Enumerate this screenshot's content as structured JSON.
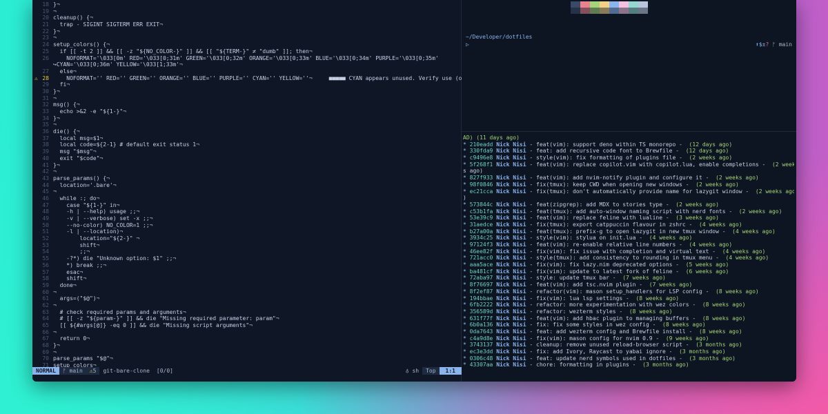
{
  "editor": {
    "lines": [
      {
        "n": "18",
        "t": "}¬"
      },
      {
        "n": "19",
        "t": "¬"
      },
      {
        "n": "20",
        "t": "cleanup() {¬"
      },
      {
        "n": "21",
        "t": "  trap - SIGINT SIGTERM ERR EXIT¬"
      },
      {
        "n": "22",
        "t": "}¬"
      },
      {
        "n": "23",
        "t": "¬"
      },
      {
        "n": "24",
        "t": "setup_colors() {¬"
      },
      {
        "n": "25",
        "t": "  if [[ -t 2 ]] && [[ -z \"${NO_COLOR-}\" ]] && [[ \"${TERM-}\" ≠ \"dumb\" ]]; then¬"
      },
      {
        "n": "26",
        "t": "    NOFORMAT='\\033[0m' RED='\\033[0;31m' GREEN='\\033[0;32m' ORANGE='\\033[0;33m' BLUE='\\033[0;34m' PURPLE='\\033[0;35m'"
      },
      {
        "n": "",
        "t": "↪CYAN='\\033[0;36m' YELLOW='\\033[1;33m'¬"
      },
      {
        "n": "27",
        "t": "  else¬"
      },
      {
        "n": "28",
        "t": "    NOFORMAT='' RED='' GREEN='' ORANGE='' BLUE='' PURPLE='' CYAN='' YELLOW=''¬     ■■■■■ CYAN appears unused. Verify use (or e",
        "warn": true
      },
      {
        "n": "29",
        "t": "  fi¬"
      },
      {
        "n": "30",
        "t": "}¬"
      },
      {
        "n": "31",
        "t": "¬"
      },
      {
        "n": "32",
        "t": "msg() {¬"
      },
      {
        "n": "33",
        "t": "  echo >&2 -e \"${1-}\"¬"
      },
      {
        "n": "34",
        "t": "}¬"
      },
      {
        "n": "35",
        "t": "¬"
      },
      {
        "n": "36",
        "t": "die() {¬"
      },
      {
        "n": "37",
        "t": "  local msg=$1¬"
      },
      {
        "n": "38",
        "t": "  local code=${2-1} # default exit status 1¬"
      },
      {
        "n": "39",
        "t": "  msg \"$msg\"¬"
      },
      {
        "n": "40",
        "t": "  exit \"$code\"¬"
      },
      {
        "n": "41",
        "t": "}¬"
      },
      {
        "n": "42",
        "t": "¬"
      },
      {
        "n": "43",
        "t": "parse_params() {¬"
      },
      {
        "n": "44",
        "t": "  location='.bare'¬"
      },
      {
        "n": "45",
        "t": "¬"
      },
      {
        "n": "46",
        "t": "  while :; do¬"
      },
      {
        "n": "47",
        "t": "    case \"${1-}\" in¬"
      },
      {
        "n": "48",
        "t": "    -h | --help) usage ;;¬"
      },
      {
        "n": "49",
        "t": "    -v | --verbose) set -x ;;¬"
      },
      {
        "n": "50",
        "t": "    --no-color) NO_COLOR=1 ;;¬"
      },
      {
        "n": "51",
        "t": "    -l | --location)¬"
      },
      {
        "n": "52",
        "t": "        location=\"${2-}\" ¬"
      },
      {
        "n": "53",
        "t": "        shift¬"
      },
      {
        "n": "54",
        "t": "        ;;¬"
      },
      {
        "n": "55",
        "t": "    -?*) die \"Unknown option: $1\" ;;¬"
      },
      {
        "n": "56",
        "t": "    *) break ;;¬"
      },
      {
        "n": "57",
        "t": "    esac¬"
      },
      {
        "n": "58",
        "t": "    shift¬"
      },
      {
        "n": "59",
        "t": "  done¬"
      },
      {
        "n": "60",
        "t": "¬"
      },
      {
        "n": "61",
        "t": "  args=(\"$@\")¬"
      },
      {
        "n": "62",
        "t": "¬"
      },
      {
        "n": "63",
        "t": "  # check required params and arguments¬"
      },
      {
        "n": "64",
        "t": "  # [[ -z \"${param-}\" ]] && die \"Missing required parameter: param\"¬"
      },
      {
        "n": "65",
        "t": "  [[ ${#args[@]} -eq 0 ]] && die \"Missing script arguments\"¬"
      },
      {
        "n": "66",
        "t": "¬"
      },
      {
        "n": "67",
        "t": "  return 0¬"
      },
      {
        "n": "68",
        "t": "}¬"
      },
      {
        "n": "69",
        "t": "¬"
      },
      {
        "n": "70",
        "t": "parse_params \"$@\"¬"
      },
      {
        "n": "71",
        "t": "setup_colors¬"
      }
    ],
    "status": {
      "mode": "NORMAL",
      "branch": "main",
      "warnings": "5",
      "file": "git-bare-clone",
      "count": "[0/0]",
      "filetype": "sh",
      "position": "Top",
      "cursor": "1:1"
    }
  },
  "terminal": {
    "cwd": "~/Developer/dotfiles",
    "prompt": "▷",
    "git_icons": "⬆$±",
    "git_q": "?",
    "git_branch": "main",
    "swatches": [
      "#3a4a66",
      "#e8828f",
      "#a6d27a",
      "#f2d085",
      "#8ab4ee",
      "#f5bfe2",
      "#94d6d0",
      "#b8c4dc"
    ],
    "log_head": "AD) (11 days ago)",
    "log": [
      {
        "h": "210eadd",
        "a": "Nick Nisi",
        "m": " - feat(vim): support deno within TS monorepo -",
        "d": "  (12 days ago)"
      },
      {
        "h": "330fda9",
        "a": "Nick Nisi",
        "m": " - feat: add recursive code font to Brewfile -",
        "d": "  (12 days ago)"
      },
      {
        "h": "c9496e8",
        "a": "Nick Nisi",
        "m": " - style(vim): fix formatting of plugins file -",
        "d": "  (2 weeks ago)"
      },
      {
        "h": "5f268f1",
        "a": "Nick Nisi",
        "m": " - feat(vim): replace copilot.vim with copilot.lua, enable completions -",
        "d": "  (2 week"
      },
      {
        "h": "",
        "a": "",
        "m": "s ago)",
        "d": ""
      },
      {
        "h": "827f933",
        "a": "Nick Nisi",
        "m": " - feat(vim): add nvim-notify plugin and configure it -",
        "d": "  (2 weeks ago)"
      },
      {
        "h": "98f0846",
        "a": "Nick Nisi",
        "m": " - fix(tmux): keep CWD when opening new windows -",
        "d": "  (2 weeks ago)"
      },
      {
        "h": "ec21cca",
        "a": "Nick Nisi",
        "m": " - fix(tmux): don't automatically provide name for lazygit window -",
        "d": "  (2 weeks ago"
      },
      {
        "h": "",
        "a": "",
        "m": ")",
        "d": ""
      },
      {
        "h": "573844c",
        "a": "Nick Nisi",
        "m": " - feat(zipgrep): add MDX to stories type -",
        "d": "  (2 weeks ago)"
      },
      {
        "h": "c53b1fa",
        "a": "Nick Nisi",
        "m": " - feat(tmux): add auto-window naming script with nerd fonts -",
        "d": "  (2 weeks ago)"
      },
      {
        "h": "53e39c9",
        "a": "Nick Nisi",
        "m": " - feat(vim): replace feline with lualine -",
        "d": "  (3 weeks ago)"
      },
      {
        "h": "31aedce",
        "a": "Nick Nisi",
        "m": " - fix(tmux): export catppuccin flavour in zshrc -",
        "d": "  (4 weeks ago)"
      },
      {
        "h": "b27a00a",
        "a": "Nick Nisi",
        "m": " - feat(tmux): prefix-g to open lazygit in new tmux window -",
        "d": "  (4 weeks ago)"
      },
      {
        "h": "3934c25",
        "a": "Nick Nisi",
        "m": " - style(vim): stylua on init.lua -",
        "d": "  (4 weeks ago)"
      },
      {
        "h": "97124f3",
        "a": "Nick Nisi",
        "m": " - feat(vim): re-enable relative line numbers -",
        "d": "  (4 weeks ago)"
      },
      {
        "h": "46ee82f",
        "a": "Nick Nisi",
        "m": " - fix(vim): fix issue with completion and virtual text -",
        "d": "  (4 weeks ago)"
      },
      {
        "h": "721acc0",
        "a": "Nick Nisi",
        "m": " - style(tmux): add consistency to rounding in tmux menu -",
        "d": "  (4 weeks ago)"
      },
      {
        "h": "aaa5ace",
        "a": "Nick Nisi",
        "m": " - fix(vim): fix lazy.nim deprecated options -",
        "d": "  (5 weeks ago)"
      },
      {
        "h": "ba481cf",
        "a": "Nick Nisi",
        "m": " - fix(vim): update to latest fork of feline -",
        "d": "  (6 weeks ago)"
      },
      {
        "h": "72aba97",
        "a": "Nick Nisi",
        "m": " - style: update tmux bar -",
        "d": "  (7 weeks ago)"
      },
      {
        "h": "8f76697",
        "a": "Nick Nisi",
        "m": " - feat(vim): add tsc.nvim plugin -",
        "d": "  (7 weeks ago)"
      },
      {
        "h": "8f2ef87",
        "a": "Nick Nisi",
        "m": " - refactor(vim): mason setup_handlers for LSP config -",
        "d": "  (8 weeks ago)"
      },
      {
        "h": "194bbae",
        "a": "Nick Nisi",
        "m": " - fix(vim): lua lsp settings -",
        "d": "  (8 weeks ago)"
      },
      {
        "h": "6fb2222",
        "a": "Nick Nisi",
        "m": " - refactor: more experimentation with wez colors -",
        "d": "  (8 weeks ago)"
      },
      {
        "h": "356589d",
        "a": "Nick Nisi",
        "m": " - refactor: wezterm styles -",
        "d": "  (8 weeks ago)"
      },
      {
        "h": "631f77f",
        "a": "Nick Nisi",
        "m": " - feat(vim): add hbac plugin to managing buffers -",
        "d": "  (8 weeks ago)"
      },
      {
        "h": "6b0a136",
        "a": "Nick Nisi",
        "m": " - fix: fix some styles in wez config -",
        "d": "  (8 weeks ago)"
      },
      {
        "h": "0da7643",
        "a": "Nick Nisi",
        "m": " - feat: add wezterm config and Brewfile install -",
        "d": "  (8 weeks ago)"
      },
      {
        "h": "c4a9d8e",
        "a": "Nick Nisi",
        "m": " - fix(vim): mason config for nvim 0.9 -",
        "d": "  (9 weeks ago)"
      },
      {
        "h": "3743137",
        "a": "Nick Nisi",
        "m": " - cleanup: remove unused reload-browser script -",
        "d": "  (3 months ago)"
      },
      {
        "h": "ec3e3dd",
        "a": "Nick Nisi",
        "m": " - fix: add Ivory, Raycast to yabai ignore -",
        "d": "  (3 months ago)"
      },
      {
        "h": "0306c48",
        "a": "Nick Nisi",
        "m": " - feat: update nerd symbols used in dotfiles -",
        "d": "  (3 months ago)"
      },
      {
        "h": "43307aa",
        "a": "Nick Nisi",
        "m": " - chore: formatting in plugins -",
        "d": "  (3 months ago)"
      }
    ]
  }
}
